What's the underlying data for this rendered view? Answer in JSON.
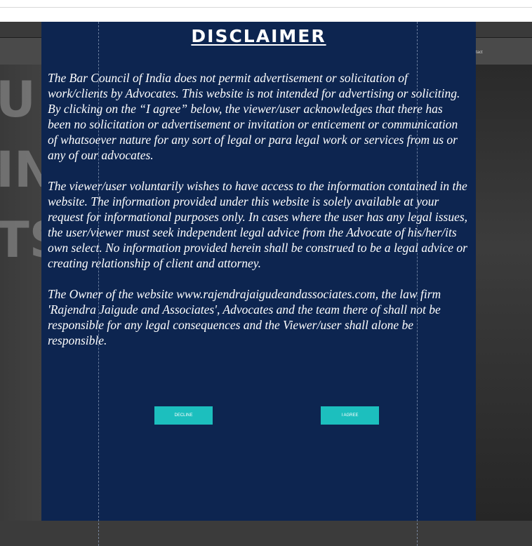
{
  "nav": {
    "contact_label": "tact"
  },
  "hero": {
    "letters": [
      "U",
      "IN",
      "TS"
    ]
  },
  "disclaimer": {
    "title": "DISCLAIMER",
    "paragraphs": [
      "The Bar Council of India does not permit advertisement or solicitation of work/clients by Advocates. This website is not intended for advertising or soliciting. By clicking on the “I agree” below, the viewer/user acknowledges that there has been no solicitation or advertisement or invitation or enticement or communication of whatsoever nature for any sort of legal or para legal work or services from us or any of our advocates.",
      "The viewer/user voluntarily wishes to have access to the information contained in the website. The information provided under this website is solely available at your request for informational purposes only. In cases where the user has any legal issues, the user/viewer must seek independent legal advice from the Advocate of his/her/its own select. No information provided herein shall be construed to be a legal advice or creating relationship of client and attorney.",
      "The Owner of the website www.rajendrajaigudeandassociates.com, the law firm 'Rajendra Jaigude and Associates', Advocates and the team there of shall not be responsible for any legal consequences and the Viewer/user shall alone be responsible."
    ],
    "decline_label": "DECLINE",
    "agree_label": "I AGREE"
  },
  "colors": {
    "modal_bg": "#0d2550",
    "button_bg": "#1cbfbe",
    "text": "#ffffff"
  }
}
